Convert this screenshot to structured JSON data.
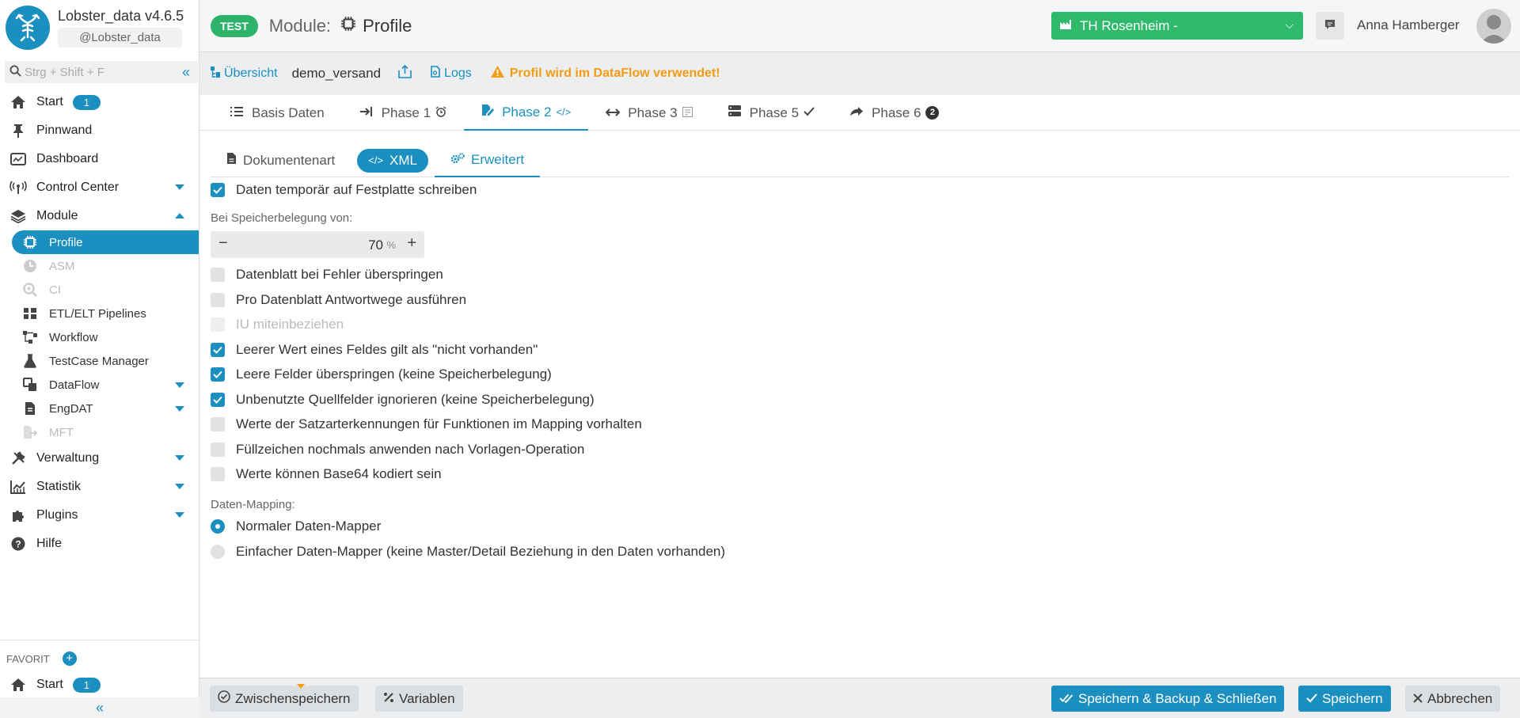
{
  "app": {
    "name": "Lobster_data v4.6.5",
    "handle": "@Lobster_data",
    "search_placeholder": "Strg + Shift + F"
  },
  "sidebar": {
    "start": {
      "label": "Start",
      "badge": "1"
    },
    "pinnwand": "Pinnwand",
    "dashboard": "Dashboard",
    "control_center": "Control Center",
    "module": "Module",
    "modules": [
      {
        "label": "Profile",
        "icon": "chip-icon",
        "state": "active"
      },
      {
        "label": "ASM",
        "icon": "clock-icon",
        "state": "disabled"
      },
      {
        "label": "CI",
        "icon": "zoom-icon",
        "state": "disabled"
      },
      {
        "label": "ETL/ELT Pipelines",
        "icon": "pipeline-icon",
        "state": "normal"
      },
      {
        "label": "Workflow",
        "icon": "workflow-icon",
        "state": "normal"
      },
      {
        "label": "TestCase Manager",
        "icon": "flask-icon",
        "state": "normal"
      },
      {
        "label": "DataFlow",
        "icon": "dataflow-icon",
        "state": "normal"
      },
      {
        "label": "EngDAT",
        "icon": "file-icon",
        "state": "normal"
      },
      {
        "label": "MFT",
        "icon": "file-export-icon",
        "state": "disabled"
      }
    ],
    "verwaltung": "Verwaltung",
    "statistik": "Statistik",
    "plugins": "Plugins",
    "hilfe": "Hilfe",
    "favorit": {
      "heading": "FAVORIT",
      "start_label": "Start",
      "start_badge": "1"
    }
  },
  "header": {
    "env_tag": "TEST",
    "module_label": "Module:",
    "module_name": "Profile",
    "organisation": "TH Rosenheim -",
    "user": "Anna Hamberger"
  },
  "breadcrumb": {
    "overview": "Übersicht",
    "current": "demo_versand",
    "logs": "Logs",
    "warning": "Profil wird im DataFlow verwendet!"
  },
  "tabs": [
    {
      "label": "Basis Daten"
    },
    {
      "label": "Phase 1"
    },
    {
      "label": "Phase 2",
      "active": true
    },
    {
      "label": "Phase 3"
    },
    {
      "label": "Phase 5"
    },
    {
      "label": "Phase 6",
      "badge": "2"
    }
  ],
  "subtabs": {
    "dokumentenart": "Dokumentenart",
    "xml": "XML",
    "erweitert": "Erweitert"
  },
  "form": {
    "temp_write": "Daten temporär auf Festplatte schreiben",
    "memory_label": "Bei Speicherbelegung von:",
    "memory_value": "70",
    "memory_unit": "%",
    "options": [
      {
        "label": "Datenblatt bei Fehler überspringen",
        "checked": false,
        "disabled": false
      },
      {
        "label": "Pro Datenblatt Antwortwege ausführen",
        "checked": false,
        "disabled": false
      },
      {
        "label": "IU miteinbeziehen",
        "checked": false,
        "disabled": true
      },
      {
        "label": "Leerer Wert eines Feldes gilt als \"nicht vorhanden\"",
        "checked": true,
        "disabled": false
      },
      {
        "label": "Leere Felder überspringen (keine Speicherbelegung)",
        "checked": true,
        "disabled": false
      },
      {
        "label": "Unbenutzte Quellfelder ignorieren (keine Speicherbelegung)",
        "checked": true,
        "disabled": false
      },
      {
        "label": "Werte der Satzarterkennungen für Funktionen im Mapping vorhalten",
        "checked": false,
        "disabled": false
      },
      {
        "label": "Füllzeichen nochmals anwenden nach Vorlagen-Operation",
        "checked": false,
        "disabled": false
      },
      {
        "label": "Werte können Base64 kodiert sein",
        "checked": false,
        "disabled": false
      }
    ],
    "mapping_label": "Daten-Mapping:",
    "mapping_options": [
      {
        "label": "Normaler Daten-Mapper",
        "selected": true
      },
      {
        "label": "Einfacher Daten-Mapper (keine Master/Detail Beziehung in den Daten vorhanden)",
        "selected": false
      }
    ]
  },
  "footer": {
    "draft": "Zwischenspeichern",
    "variables": "Variablen",
    "save_backup_close": "Speichern & Backup & Schließen",
    "save": "Speichern",
    "cancel": "Abbrechen"
  },
  "colors": {
    "accent": "#1a8fc0",
    "success": "#2fb96b",
    "warning": "#f39c12"
  }
}
